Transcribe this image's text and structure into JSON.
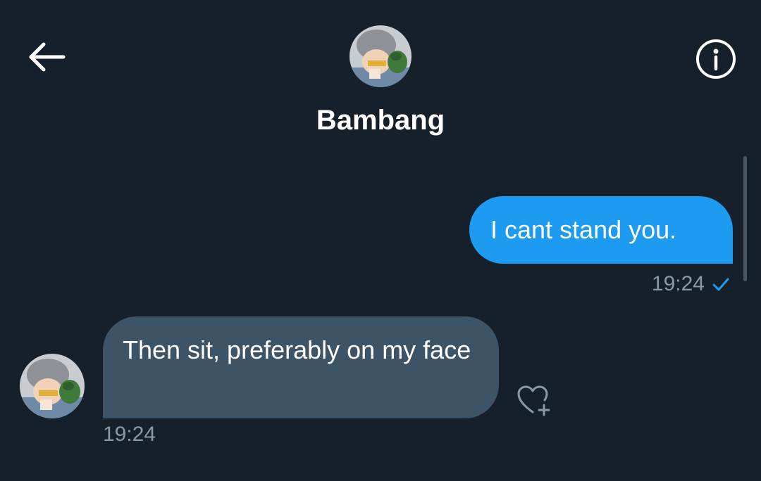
{
  "header": {
    "contact_name": "Bambang",
    "back_icon": "arrow-left-icon",
    "info_icon": "info-circle-icon",
    "avatar_icon": "avatar-image"
  },
  "messages": [
    {
      "direction": "outgoing",
      "text": "I cant stand you.",
      "time": "19:24",
      "status_icon": "checkmark-icon"
    },
    {
      "direction": "incoming",
      "text": "Then sit, preferably on my face",
      "time": "19:24",
      "reaction_icon": "heart-plus-icon"
    }
  ],
  "colors": {
    "background": "#15202b",
    "outgoing_bubble": "#1d9bf0",
    "incoming_bubble": "#3d5466",
    "meta_text": "#8b98a5",
    "icon": "#ffffff"
  }
}
